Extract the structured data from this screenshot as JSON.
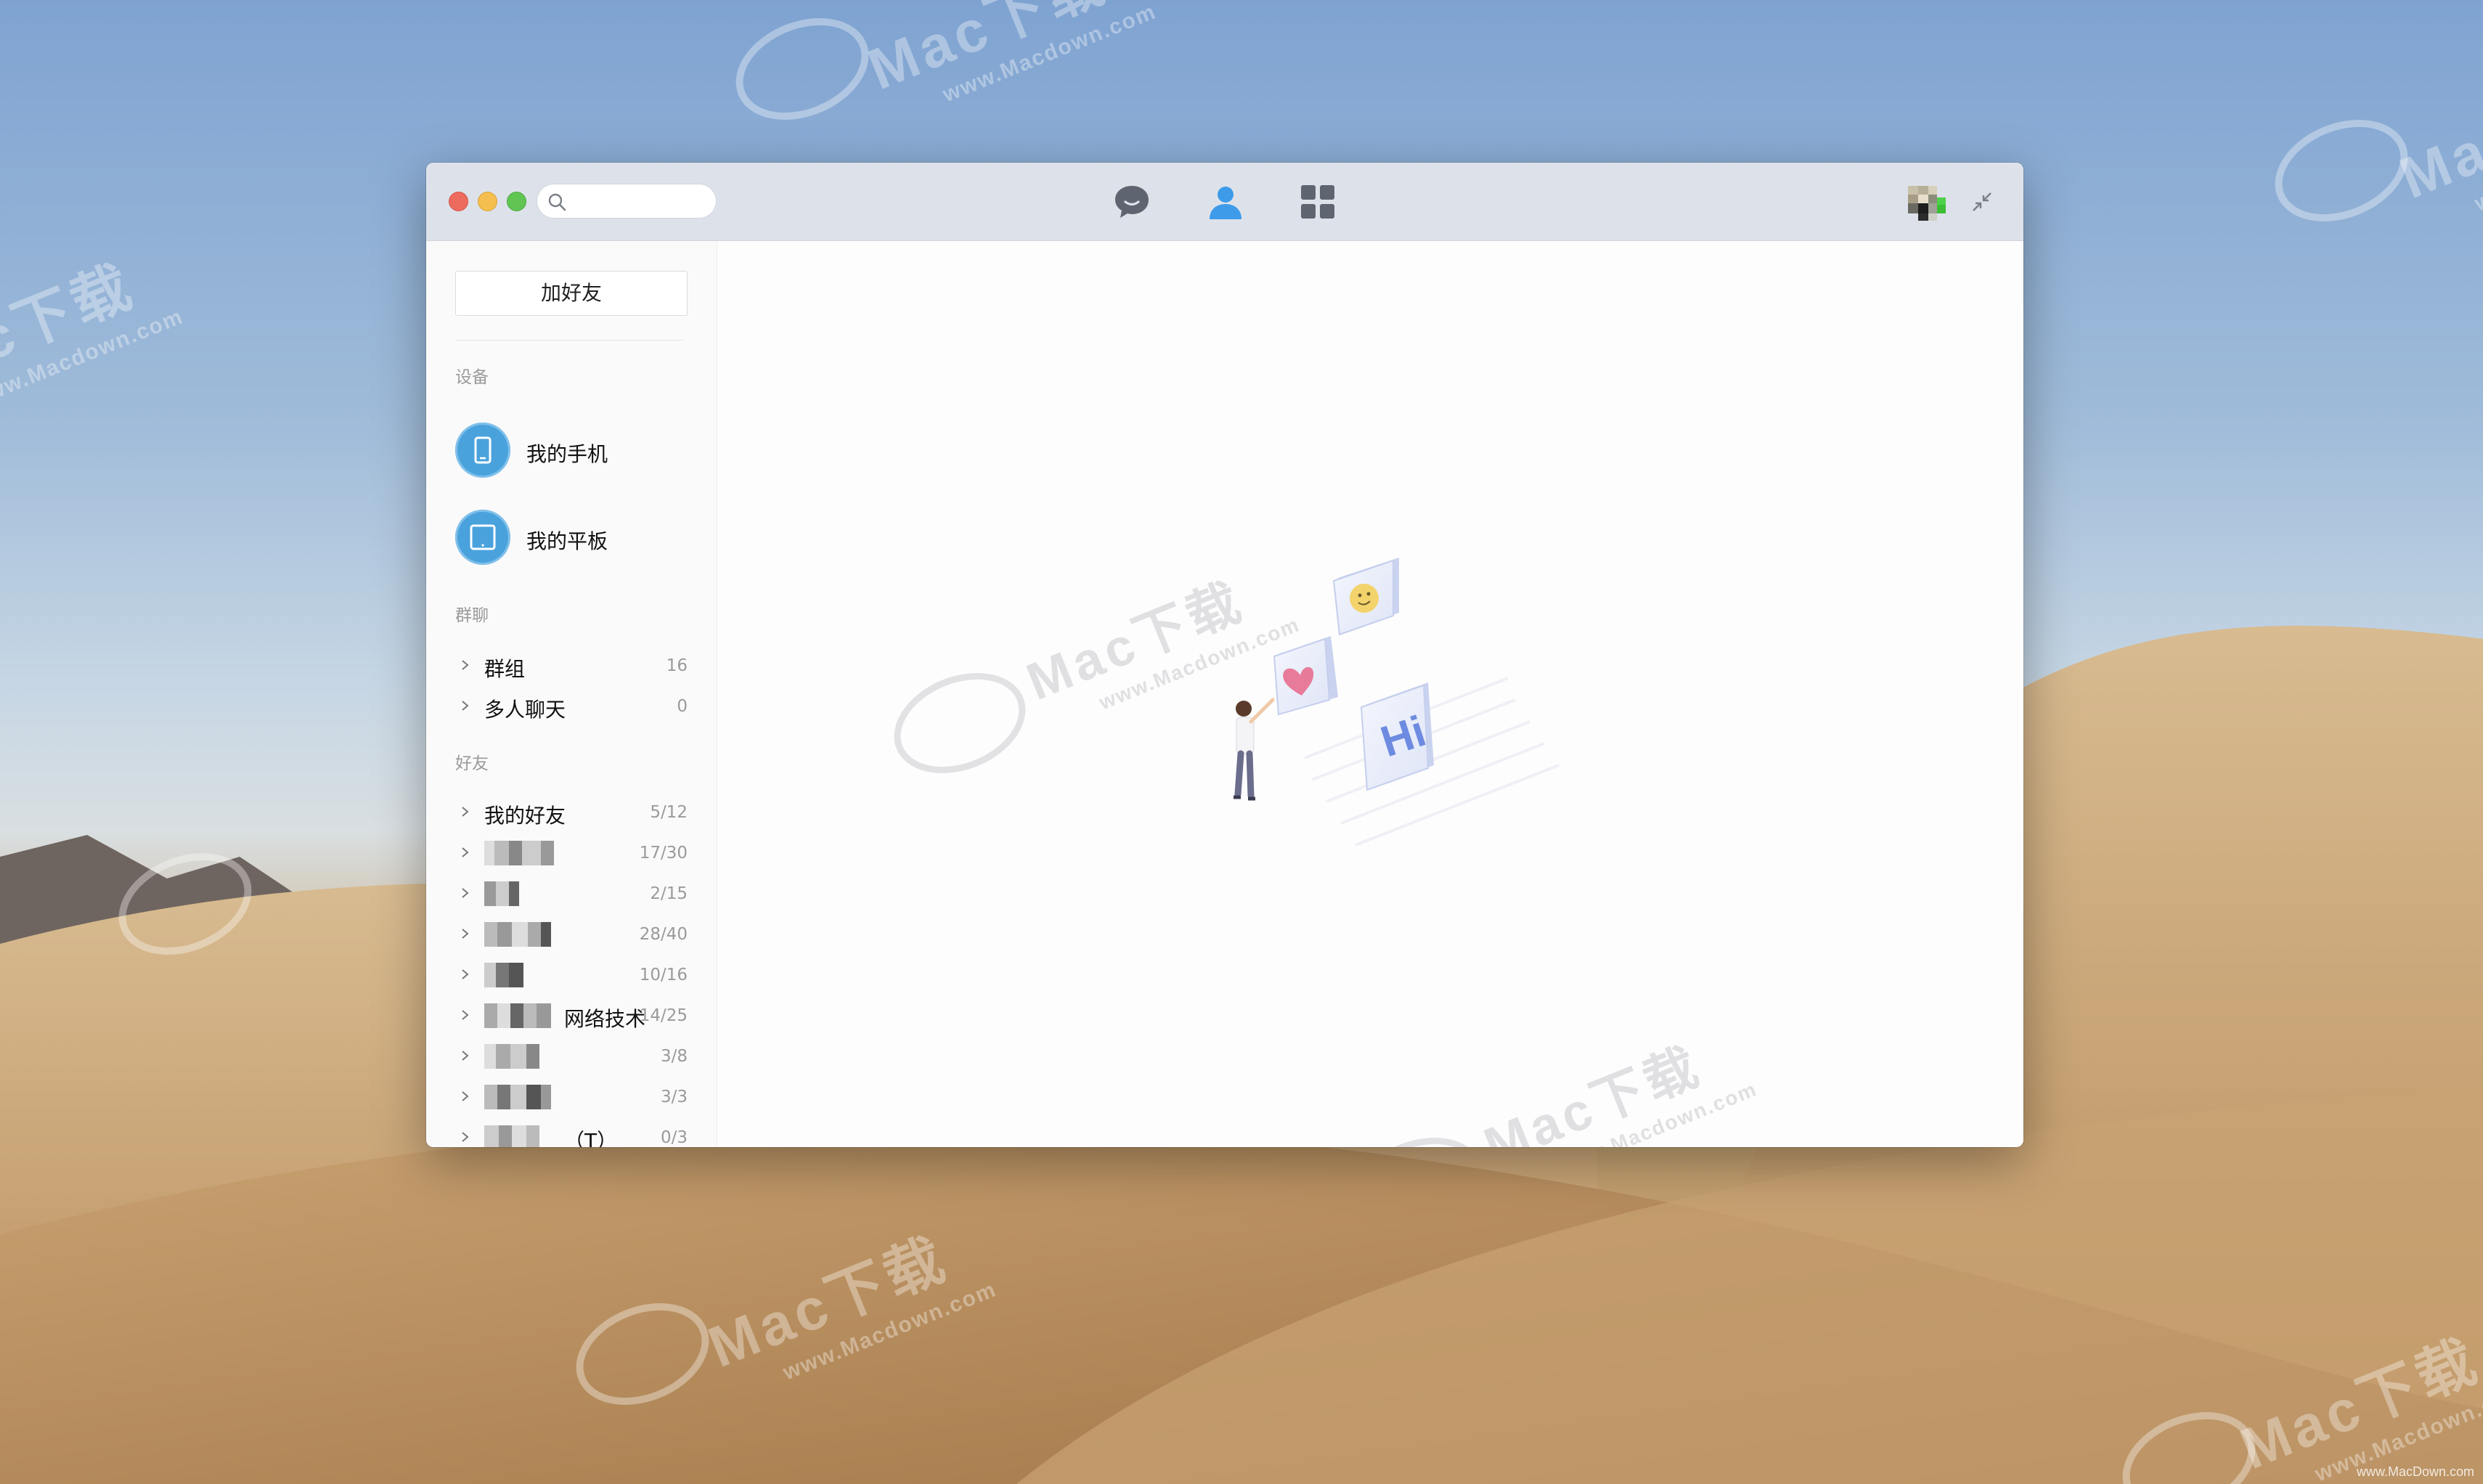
{
  "watermark": {
    "brand": "Mac下载",
    "url": "www.Macdown.com",
    "footer": "www.MacDown.com"
  },
  "search": {
    "placeholder": ""
  },
  "sidebar": {
    "add_friend_label": "加好友",
    "devices_header": "设备",
    "devices": [
      {
        "label": "我的手机",
        "icon": "phone-icon"
      },
      {
        "label": "我的平板",
        "icon": "tablet-icon"
      }
    ],
    "groups_header": "群聊",
    "groups": [
      {
        "label": "群组",
        "count": "16"
      },
      {
        "label": "多人聊天",
        "count": "0"
      }
    ],
    "friends_header": "好友",
    "friends": [
      {
        "label": "我的好友",
        "count": "5/12",
        "blurred": false
      },
      {
        "label": "",
        "count": "17/30",
        "blurred": true
      },
      {
        "label": "",
        "count": "2/15",
        "blurred": true
      },
      {
        "label": "",
        "count": "28/40",
        "blurred": true
      },
      {
        "label": "",
        "count": "10/16",
        "blurred": true
      },
      {
        "label": "网络技术",
        "count": "14/25",
        "blurred": true
      },
      {
        "label": "",
        "count": "3/8",
        "blurred": true
      },
      {
        "label": "",
        "count": "3/3",
        "blurred": true
      },
      {
        "label": "（T）",
        "count": "0/3",
        "blurred": true
      }
    ]
  },
  "toolbar": {
    "tabs": [
      "messages-tab",
      "contacts-tab",
      "apps-tab"
    ],
    "active_tab": "contacts-tab"
  },
  "colors": {
    "accent": "#3d9be9",
    "inactive_icon": "#5e6570",
    "titlebar": "#dde2ea"
  }
}
